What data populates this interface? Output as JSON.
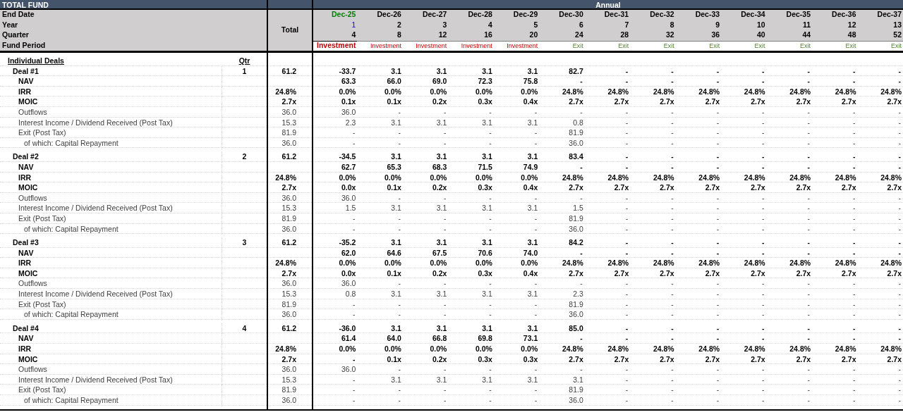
{
  "title": "TOTAL FUND",
  "annual_label": "Annual",
  "total_label": "Total",
  "header_labels": [
    "End Date",
    "Year",
    "Quarter",
    "Fund Period"
  ],
  "columns": [
    {
      "date": "Dec-25",
      "year": "1",
      "quarter": "4",
      "period": "Investment",
      "kind": "investment",
      "current": true
    },
    {
      "date": "Dec-26",
      "year": "2",
      "quarter": "8",
      "period": "Investment",
      "kind": "investment",
      "current": false
    },
    {
      "date": "Dec-27",
      "year": "3",
      "quarter": "12",
      "period": "Investment",
      "kind": "investment",
      "current": false
    },
    {
      "date": "Dec-28",
      "year": "4",
      "quarter": "16",
      "period": "Investment",
      "kind": "investment",
      "current": false
    },
    {
      "date": "Dec-29",
      "year": "5",
      "quarter": "20",
      "period": "Investment",
      "kind": "investment",
      "current": false
    },
    {
      "date": "Dec-30",
      "year": "6",
      "quarter": "24",
      "period": "Exit",
      "kind": "exit",
      "current": false
    },
    {
      "date": "Dec-31",
      "year": "7",
      "quarter": "28",
      "period": "Exit",
      "kind": "exit",
      "current": false
    },
    {
      "date": "Dec-32",
      "year": "8",
      "quarter": "32",
      "period": "Exit",
      "kind": "exit",
      "current": false
    },
    {
      "date": "Dec-33",
      "year": "9",
      "quarter": "36",
      "period": "Exit",
      "kind": "exit",
      "current": false
    },
    {
      "date": "Dec-34",
      "year": "10",
      "quarter": "40",
      "period": "Exit",
      "kind": "exit",
      "current": false
    },
    {
      "date": "Dec-35",
      "year": "11",
      "quarter": "44",
      "period": "Exit",
      "kind": "exit",
      "current": false
    },
    {
      "date": "Dec-36",
      "year": "12",
      "quarter": "48",
      "period": "Exit",
      "kind": "exit",
      "current": false
    },
    {
      "date": "Dec-37",
      "year": "13",
      "quarter": "52",
      "period": "Exit",
      "kind": "exit",
      "current": false
    }
  ],
  "section": {
    "label": "Individual Deals",
    "qtr_label": "Qtr"
  },
  "deals": [
    {
      "rows": [
        {
          "kind": "deal",
          "label": "Deal #1",
          "qtr": "1",
          "total": "61.2",
          "values": [
            "-33.7",
            "3.1",
            "3.1",
            "3.1",
            "3.1",
            "82.7",
            "-",
            "-",
            "-",
            "-",
            "-",
            "-",
            "-"
          ]
        },
        {
          "kind": "metric",
          "label": "NAV",
          "total": "",
          "values": [
            "63.3",
            "66.0",
            "69.0",
            "72.3",
            "75.8",
            "-",
            "-",
            "-",
            "-",
            "-",
            "-",
            "-",
            "-"
          ]
        },
        {
          "kind": "metric",
          "label": "IRR",
          "total": "24.8%",
          "values": [
            "0.0%",
            "0.0%",
            "0.0%",
            "0.0%",
            "0.0%",
            "24.8%",
            "24.8%",
            "24.8%",
            "24.8%",
            "24.8%",
            "24.8%",
            "24.8%",
            "24.8%"
          ]
        },
        {
          "kind": "metric",
          "label": "MOIC",
          "total": "2.7x",
          "values": [
            "0.1x",
            "0.1x",
            "0.2x",
            "0.3x",
            "0.4x",
            "2.7x",
            "2.7x",
            "2.7x",
            "2.7x",
            "2.7x",
            "2.7x",
            "2.7x",
            "2.7x"
          ]
        },
        {
          "kind": "line",
          "label": "Outflows",
          "total": "36.0",
          "values": [
            "36.0",
            "-",
            "-",
            "-",
            "-",
            "-",
            "-",
            "-",
            "-",
            "-",
            "-",
            "-",
            "-"
          ]
        },
        {
          "kind": "line",
          "label": "Interest Income / Dividend Received (Post Tax)",
          "total": "15.3",
          "values": [
            "2.3",
            "3.1",
            "3.1",
            "3.1",
            "3.1",
            "0.8",
            "-",
            "-",
            "-",
            "-",
            "-",
            "-",
            "-"
          ]
        },
        {
          "kind": "line",
          "label": "Exit (Post Tax)",
          "total": "81.9",
          "values": [
            "-",
            "-",
            "-",
            "-",
            "-",
            "81.9",
            "-",
            "-",
            "-",
            "-",
            "-",
            "-",
            "-"
          ]
        },
        {
          "kind": "sub",
          "label": "of which: Capital Repayment",
          "total": "36.0",
          "values": [
            "-",
            "-",
            "-",
            "-",
            "-",
            "36.0",
            "-",
            "-",
            "-",
            "-",
            "-",
            "-",
            "-"
          ]
        }
      ]
    },
    {
      "rows": [
        {
          "kind": "deal",
          "label": "Deal #2",
          "qtr": "2",
          "total": "61.2",
          "values": [
            "-34.5",
            "3.1",
            "3.1",
            "3.1",
            "3.1",
            "83.4",
            "-",
            "-",
            "-",
            "-",
            "-",
            "-",
            "-"
          ]
        },
        {
          "kind": "metric",
          "label": "NAV",
          "total": "",
          "values": [
            "62.7",
            "65.3",
            "68.3",
            "71.5",
            "74.9",
            "-",
            "-",
            "-",
            "-",
            "-",
            "-",
            "-",
            "-"
          ]
        },
        {
          "kind": "metric",
          "label": "IRR",
          "total": "24.8%",
          "values": [
            "0.0%",
            "0.0%",
            "0.0%",
            "0.0%",
            "0.0%",
            "24.8%",
            "24.8%",
            "24.8%",
            "24.8%",
            "24.8%",
            "24.8%",
            "24.8%",
            "24.8%"
          ]
        },
        {
          "kind": "metric",
          "label": "MOIC",
          "total": "2.7x",
          "values": [
            "0.0x",
            "0.1x",
            "0.2x",
            "0.3x",
            "0.4x",
            "2.7x",
            "2.7x",
            "2.7x",
            "2.7x",
            "2.7x",
            "2.7x",
            "2.7x",
            "2.7x"
          ]
        },
        {
          "kind": "line",
          "label": "Outflows",
          "total": "36.0",
          "values": [
            "36.0",
            "-",
            "-",
            "-",
            "-",
            "-",
            "-",
            "-",
            "-",
            "-",
            "-",
            "-",
            "-"
          ]
        },
        {
          "kind": "line",
          "label": "Interest Income / Dividend Received (Post Tax)",
          "total": "15.3",
          "values": [
            "1.5",
            "3.1",
            "3.1",
            "3.1",
            "3.1",
            "1.5",
            "-",
            "-",
            "-",
            "-",
            "-",
            "-",
            "-"
          ]
        },
        {
          "kind": "line",
          "label": "Exit (Post Tax)",
          "total": "81.9",
          "values": [
            "-",
            "-",
            "-",
            "-",
            "-",
            "81.9",
            "-",
            "-",
            "-",
            "-",
            "-",
            "-",
            "-"
          ]
        },
        {
          "kind": "sub",
          "label": "of which: Capital Repayment",
          "total": "36.0",
          "values": [
            "-",
            "-",
            "-",
            "-",
            "-",
            "36.0",
            "-",
            "-",
            "-",
            "-",
            "-",
            "-",
            "-"
          ]
        }
      ]
    },
    {
      "rows": [
        {
          "kind": "deal",
          "label": "Deal #3",
          "qtr": "3",
          "total": "61.2",
          "values": [
            "-35.2",
            "3.1",
            "3.1",
            "3.1",
            "3.1",
            "84.2",
            "-",
            "-",
            "-",
            "-",
            "-",
            "-",
            "-"
          ]
        },
        {
          "kind": "metric",
          "label": "NAV",
          "total": "",
          "values": [
            "62.0",
            "64.6",
            "67.5",
            "70.6",
            "74.0",
            "-",
            "-",
            "-",
            "-",
            "-",
            "-",
            "-",
            "-"
          ]
        },
        {
          "kind": "metric",
          "label": "IRR",
          "total": "24.8%",
          "values": [
            "0.0%",
            "0.0%",
            "0.0%",
            "0.0%",
            "0.0%",
            "24.8%",
            "24.8%",
            "24.8%",
            "24.8%",
            "24.8%",
            "24.8%",
            "24.8%",
            "24.8%"
          ]
        },
        {
          "kind": "metric",
          "label": "MOIC",
          "total": "2.7x",
          "values": [
            "0.0x",
            "0.1x",
            "0.2x",
            "0.3x",
            "0.4x",
            "2.7x",
            "2.7x",
            "2.7x",
            "2.7x",
            "2.7x",
            "2.7x",
            "2.7x",
            "2.7x"
          ]
        },
        {
          "kind": "line",
          "label": "Outflows",
          "total": "36.0",
          "values": [
            "36.0",
            "-",
            "-",
            "-",
            "-",
            "-",
            "-",
            "-",
            "-",
            "-",
            "-",
            "-",
            "-"
          ]
        },
        {
          "kind": "line",
          "label": "Interest Income / Dividend Received (Post Tax)",
          "total": "15.3",
          "values": [
            "0.8",
            "3.1",
            "3.1",
            "3.1",
            "3.1",
            "2.3",
            "-",
            "-",
            "-",
            "-",
            "-",
            "-",
            "-"
          ]
        },
        {
          "kind": "line",
          "label": "Exit (Post Tax)",
          "total": "81.9",
          "values": [
            "-",
            "-",
            "-",
            "-",
            "-",
            "81.9",
            "-",
            "-",
            "-",
            "-",
            "-",
            "-",
            "-"
          ]
        },
        {
          "kind": "sub",
          "label": "of which: Capital Repayment",
          "total": "36.0",
          "values": [
            "-",
            "-",
            "-",
            "-",
            "-",
            "36.0",
            "-",
            "-",
            "-",
            "-",
            "-",
            "-",
            "-"
          ]
        }
      ]
    },
    {
      "rows": [
        {
          "kind": "deal",
          "label": "Deal #4",
          "qtr": "4",
          "total": "61.2",
          "values": [
            "-36.0",
            "3.1",
            "3.1",
            "3.1",
            "3.1",
            "85.0",
            "-",
            "-",
            "-",
            "-",
            "-",
            "-",
            "-"
          ]
        },
        {
          "kind": "metric",
          "label": "NAV",
          "total": "",
          "values": [
            "61.4",
            "64.0",
            "66.8",
            "69.8",
            "73.1",
            "-",
            "-",
            "-",
            "-",
            "-",
            "-",
            "-",
            "-"
          ]
        },
        {
          "kind": "metric",
          "label": "IRR",
          "total": "24.8%",
          "values": [
            "0.0%",
            "0.0%",
            "0.0%",
            "0.0%",
            "0.0%",
            "24.8%",
            "24.8%",
            "24.8%",
            "24.8%",
            "24.8%",
            "24.8%",
            "24.8%",
            "24.8%"
          ]
        },
        {
          "kind": "metric",
          "label": "MOIC",
          "total": "2.7x",
          "values": [
            "-",
            "0.1x",
            "0.2x",
            "0.3x",
            "0.3x",
            "2.7x",
            "2.7x",
            "2.7x",
            "2.7x",
            "2.7x",
            "2.7x",
            "2.7x",
            "2.7x"
          ]
        },
        {
          "kind": "line",
          "label": "Outflows",
          "total": "36.0",
          "values": [
            "36.0",
            "-",
            "-",
            "-",
            "-",
            "-",
            "-",
            "-",
            "-",
            "-",
            "-",
            "-",
            "-"
          ]
        },
        {
          "kind": "line",
          "label": "Interest Income / Dividend Received (Post Tax)",
          "total": "15.3",
          "values": [
            "-",
            "3.1",
            "3.1",
            "3.1",
            "3.1",
            "3.1",
            "-",
            "-",
            "-",
            "-",
            "-",
            "-",
            "-"
          ]
        },
        {
          "kind": "line",
          "label": "Exit (Post Tax)",
          "total": "81.9",
          "values": [
            "-",
            "-",
            "-",
            "-",
            "-",
            "81.9",
            "-",
            "-",
            "-",
            "-",
            "-",
            "-",
            "-"
          ]
        },
        {
          "kind": "sub",
          "label": "of which: Capital Repayment",
          "total": "36.0",
          "values": [
            "-",
            "-",
            "-",
            "-",
            "-",
            "36.0",
            "-",
            "-",
            "-",
            "-",
            "-",
            "-",
            "-"
          ]
        }
      ]
    }
  ]
}
